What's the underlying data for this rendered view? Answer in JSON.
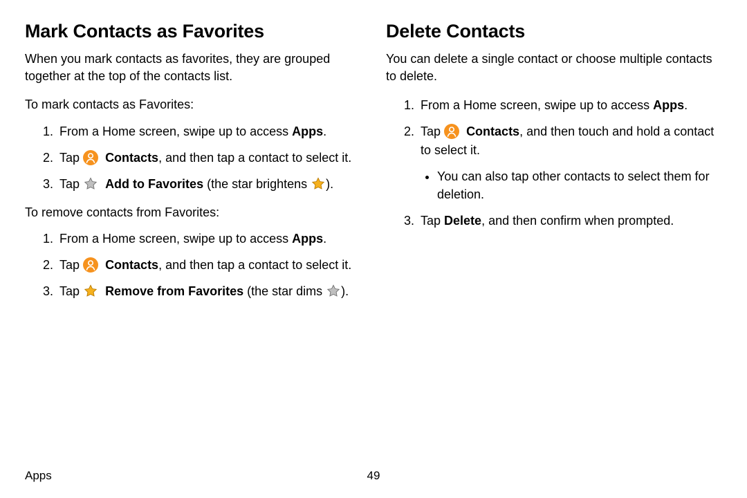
{
  "left": {
    "heading": "Mark Contacts as Favorites",
    "intro": "When you mark contacts as favorites, they are grouped together at the top of the contacts list.",
    "lead1": "To mark contacts as Favorites:",
    "s1a": "From a Home screen, swipe up to access ",
    "s1a_b": "Apps",
    "s1a_end": ".",
    "s2a_pre": "Tap ",
    "s2a_b": "Contacts",
    "s2a_post": ", and then tap a contact to select it.",
    "s3a_pre": "Tap ",
    "s3a_b": "Add to Favorites",
    "s3a_mid": " (the star brightens ",
    "s3a_end": ").",
    "lead2": "To remove contacts from Favorites:",
    "s1b": "From a Home screen, swipe up to access ",
    "s1b_b": "Apps",
    "s1b_end": ".",
    "s2b_pre": "Tap ",
    "s2b_b": "Contacts",
    "s2b_post": ", and then tap a contact to select it.",
    "s3b_pre": "Tap ",
    "s3b_b": "Remove from Favorites",
    "s3b_mid": " (the star dims ",
    "s3b_end": ")."
  },
  "right": {
    "heading": "Delete Contacts",
    "intro": "You can delete a single contact or choose multiple contacts to delete.",
    "s1": "From a Home screen, swipe up to access ",
    "s1_b": "Apps",
    "s1_end": ".",
    "s2_pre": "Tap ",
    "s2_b": "Contacts",
    "s2_post": ", and then touch and hold a contact to select it.",
    "s2_sub": "You can also tap other contacts to select them for deletion.",
    "s3_pre": "Tap ",
    "s3_b": "Delete",
    "s3_post": ", and then confirm when prompted."
  },
  "footer": {
    "section": "Apps",
    "page": "49"
  }
}
